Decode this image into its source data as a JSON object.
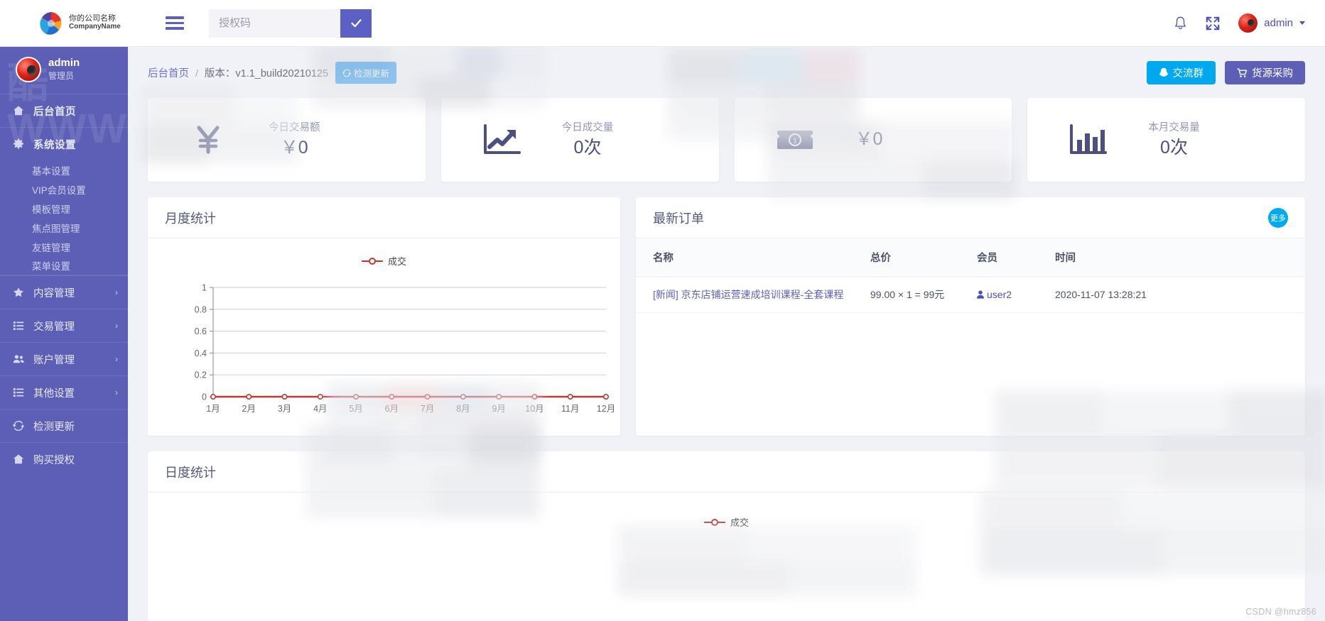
{
  "topbar": {
    "brand_cn": "你的公司名称",
    "brand_en": "CompanyName",
    "logo_icon": "colorful-sphere-logo",
    "menu_icon": "hamburger-icon",
    "search_placeholder": "授权码",
    "search_value": "",
    "search_submit_icon": "check-icon",
    "bell_icon": "bell-icon",
    "fullscreen_icon": "fullscreen-icon",
    "avatar_icon": "user-avatar",
    "user_name": "admin",
    "caret_icon": "chevron-down-icon"
  },
  "sidebar": {
    "watermark_text": "酷WWW",
    "profile": {
      "name": "admin",
      "role": "管理员",
      "avatar_icon": "user-avatar"
    },
    "items": [
      {
        "label": "后台首页",
        "icon": "home-icon",
        "arrow": "",
        "group": true
      },
      {
        "label": "系统设置",
        "icon": "gear-icon",
        "arrow": "",
        "group": true
      }
    ],
    "sub_items": [
      {
        "label": "基本设置"
      },
      {
        "label": "VIP会员设置"
      },
      {
        "label": "模板管理"
      },
      {
        "label": "焦点图管理"
      },
      {
        "label": "友链管理"
      },
      {
        "label": "菜单设置"
      }
    ],
    "items2": [
      {
        "label": "内容管理",
        "icon": "star-icon",
        "arrow": "›"
      },
      {
        "label": "交易管理",
        "icon": "list-icon",
        "arrow": "›"
      },
      {
        "label": "账户管理",
        "icon": "users-icon",
        "arrow": "›"
      },
      {
        "label": "其他设置",
        "icon": "list-icon",
        "arrow": "›"
      },
      {
        "label": "检测更新",
        "icon": "refresh-icon",
        "arrow": ""
      },
      {
        "label": "购买授权",
        "icon": "home-icon",
        "arrow": ""
      }
    ]
  },
  "breadcrumb": {
    "home": "后台首页",
    "separator": "/",
    "version": "版本：v1.1_build20210125",
    "update_button": "检测更新",
    "update_icon": "refresh-icon",
    "qq_button": "交流群",
    "qq_icon": "qq-penguin-icon",
    "buy_button": "货源采购",
    "buy_icon": "cart-icon"
  },
  "cards": [
    {
      "icon": "yen-sign-icon",
      "label": "今日交易额",
      "value": "￥0"
    },
    {
      "icon": "line-chart-icon",
      "label": "今日成交量",
      "value": "0次"
    },
    {
      "icon": "money-bill-icon",
      "label": "",
      "value": "￥0"
    },
    {
      "icon": "bar-chart-icon",
      "label": "本月交易量",
      "value": "0次"
    }
  ],
  "monthly_panel": {
    "title": "月度统计"
  },
  "daily_panel": {
    "title": "日度统计"
  },
  "orders_panel": {
    "title": "最新订单",
    "more_label": "更多",
    "columns": [
      "名称",
      "总价",
      "会员",
      "时间"
    ],
    "rows": [
      {
        "tag": "[新闻]",
        "name": "京东店铺运营速成培训课程-全套课程",
        "price": "99.00 × 1 = 99元",
        "member": "user2",
        "member_icon": "user-icon",
        "time": "2020-11-07 13:28:21"
      }
    ]
  },
  "footer": {
    "csdn_watermark": "CSDN @hmz856"
  },
  "chart_data": [
    {
      "type": "line",
      "title": "月度统计",
      "legend": [
        "成交"
      ],
      "legend_position": "top-center",
      "categories": [
        "1月",
        "2月",
        "3月",
        "4月",
        "5月",
        "6月",
        "7月",
        "8月",
        "9月",
        "10月",
        "11月",
        "12月"
      ],
      "series": [
        {
          "name": "成交",
          "values": [
            0,
            0,
            0,
            0,
            0,
            0,
            0,
            0,
            0,
            0,
            0,
            0
          ],
          "color": "#c23531"
        }
      ],
      "ylim": [
        0,
        1
      ],
      "yticks": [
        "0",
        "0.2",
        "0.4",
        "0.6",
        "0.8",
        "1"
      ],
      "xlabel": "",
      "ylabel": "",
      "grid": true
    },
    {
      "type": "line",
      "title": "日度统计",
      "legend": [
        "成交"
      ],
      "legend_position": "top-center",
      "categories": [],
      "series": [
        {
          "name": "成交",
          "values": [],
          "color": "#c23531"
        }
      ],
      "grid": true
    }
  ]
}
